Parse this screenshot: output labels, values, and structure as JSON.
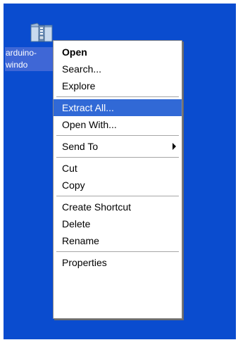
{
  "desktop": {
    "icon": {
      "name_label": "arduino-\n   windo",
      "icon_name": "zip-folder-icon"
    }
  },
  "context_menu": {
    "groups": [
      [
        {
          "label": "Open",
          "bold": true
        },
        {
          "label": "Search...",
          "bold": false
        },
        {
          "label": "Explore",
          "bold": false
        }
      ],
      [
        {
          "label": "Extract All...",
          "highlighted": true
        },
        {
          "label": "Open With...",
          "highlighted": false
        }
      ],
      [
        {
          "label": "Send To",
          "has_submenu": true
        }
      ],
      [
        {
          "label": "Cut"
        },
        {
          "label": "Copy"
        }
      ],
      [
        {
          "label": "Create Shortcut"
        },
        {
          "label": "Delete"
        },
        {
          "label": "Rename"
        }
      ],
      [
        {
          "label": "Properties"
        }
      ]
    ]
  },
  "colors": {
    "desktop_background": "#0a4ccf",
    "highlight": "#3169d6",
    "menu_background": "#ffffff"
  }
}
